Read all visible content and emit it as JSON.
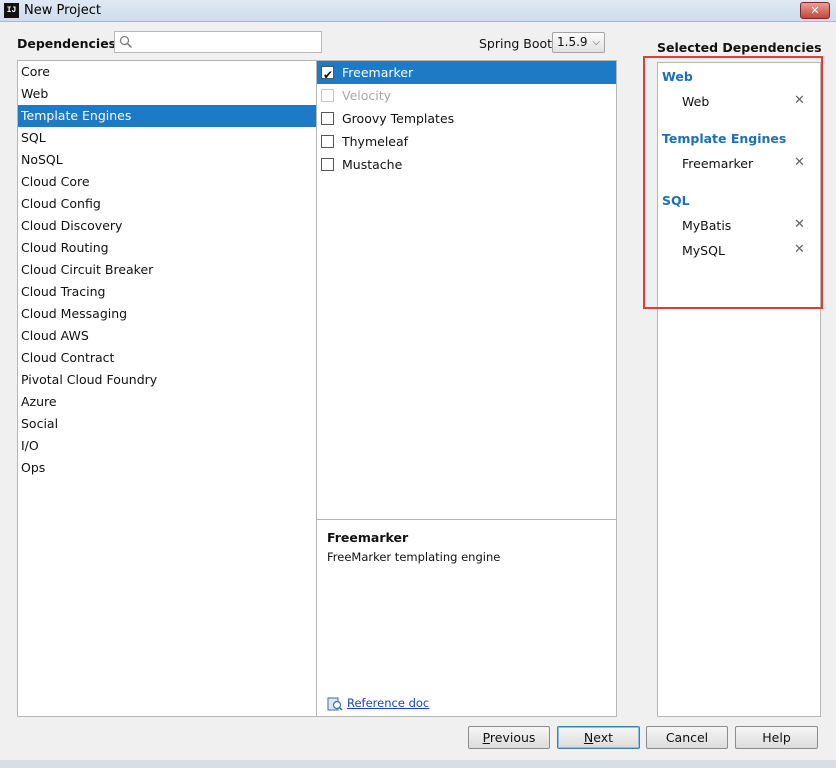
{
  "window": {
    "app_icon_text": "IJ",
    "title": "New Project",
    "close_glyph": "✕"
  },
  "header": {
    "dependencies_label": "Dependencies",
    "search": {
      "value": "",
      "placeholder": ""
    },
    "spring_boot_label": "Spring Boot",
    "spring_boot_version": "1.5.9"
  },
  "categories": {
    "selected": "Template Engines",
    "items": [
      "Core",
      "Web",
      "Template Engines",
      "SQL",
      "NoSQL",
      "Cloud Core",
      "Cloud Config",
      "Cloud Discovery",
      "Cloud Routing",
      "Cloud Circuit Breaker",
      "Cloud Tracing",
      "Cloud Messaging",
      "Cloud AWS",
      "Cloud Contract",
      "Pivotal Cloud Foundry",
      "Azure",
      "Social",
      "I/O",
      "Ops"
    ]
  },
  "dependencies": {
    "items": [
      {
        "label": "Freemarker",
        "checked": true,
        "selected": true,
        "disabled": false
      },
      {
        "label": "Velocity",
        "checked": false,
        "selected": false,
        "disabled": true
      },
      {
        "label": "Groovy Templates",
        "checked": false,
        "selected": false,
        "disabled": false
      },
      {
        "label": "Thymeleaf",
        "checked": false,
        "selected": false,
        "disabled": false
      },
      {
        "label": "Mustache",
        "checked": false,
        "selected": false,
        "disabled": false
      }
    ]
  },
  "description": {
    "title": "Freemarker",
    "text": "FreeMarker templating engine",
    "reference_doc_label": "Reference doc"
  },
  "selected_dependencies": {
    "heading": "Selected Dependencies",
    "remove_glyph": "✕",
    "groups": [
      {
        "name": "Web",
        "items": [
          "Web"
        ]
      },
      {
        "name": "Template Engines",
        "items": [
          "Freemarker"
        ]
      },
      {
        "name": "SQL",
        "items": [
          "MyBatis",
          "MySQL"
        ]
      }
    ]
  },
  "buttons": {
    "previous": {
      "mnemonic": "P",
      "rest": "revious"
    },
    "next": {
      "mnemonic": "N",
      "rest": "ext"
    },
    "cancel": "Cancel",
    "help": "Help"
  },
  "colors": {
    "selection": "#1c7ac6",
    "group_label": "#1c6fb8",
    "highlight_box": "#e53a3a",
    "link": "#1a43c8"
  }
}
